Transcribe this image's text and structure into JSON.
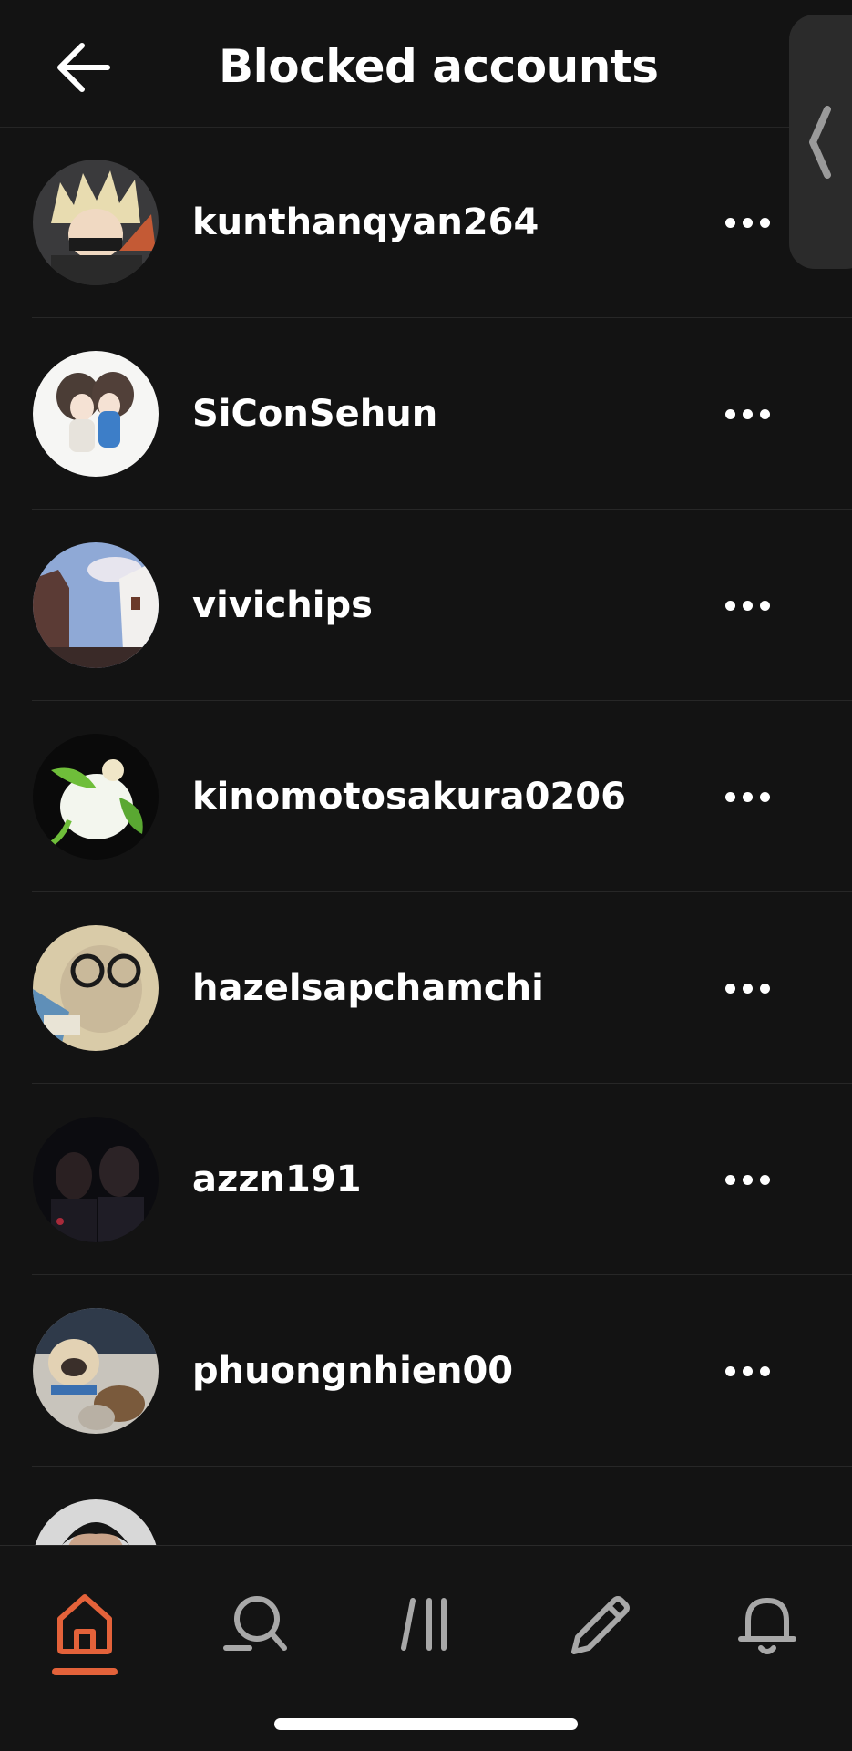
{
  "header": {
    "title": "Blocked accounts",
    "back_icon": "arrow-left-icon"
  },
  "side_panel": {
    "icon": "chevron-left-icon"
  },
  "blocked_accounts": [
    {
      "username": "kunthanqyan264",
      "avatar": "anime-character-avatar",
      "more_icon": "more-horizontal-icon"
    },
    {
      "username": "SiConSehun",
      "avatar": "couple-illustration-avatar",
      "more_icon": "more-horizontal-icon"
    },
    {
      "username": "vivichips",
      "avatar": "sky-buildings-avatar",
      "more_icon": "more-horizontal-icon"
    },
    {
      "username": "kinomotosakura0206",
      "avatar": "anime-flower-avatar",
      "more_icon": "more-horizontal-icon"
    },
    {
      "username": "hazelsapchamchi",
      "avatar": "cat-with-glasses-avatar",
      "more_icon": "more-horizontal-icon"
    },
    {
      "username": "azzn191",
      "avatar": "dark-photo-avatar",
      "more_icon": "more-horizontal-icon"
    },
    {
      "username": "phuongnhien00",
      "avatar": "pug-dog-avatar",
      "more_icon": "more-horizontal-icon"
    },
    {
      "username": "",
      "avatar": "person-avatar",
      "more_icon": "more-horizontal-icon"
    }
  ],
  "bottom_nav": {
    "active_tab": "home",
    "items": [
      {
        "id": "home",
        "icon": "home-icon"
      },
      {
        "id": "search",
        "icon": "search-icon"
      },
      {
        "id": "library",
        "icon": "library-icon"
      },
      {
        "id": "write",
        "icon": "pencil-icon"
      },
      {
        "id": "notifications",
        "icon": "bell-icon"
      }
    ]
  },
  "colors": {
    "background": "#131313",
    "text": "#ffffff",
    "accent": "#e4623a",
    "icon_inactive": "#a8a8a8",
    "divider": "#272727"
  }
}
